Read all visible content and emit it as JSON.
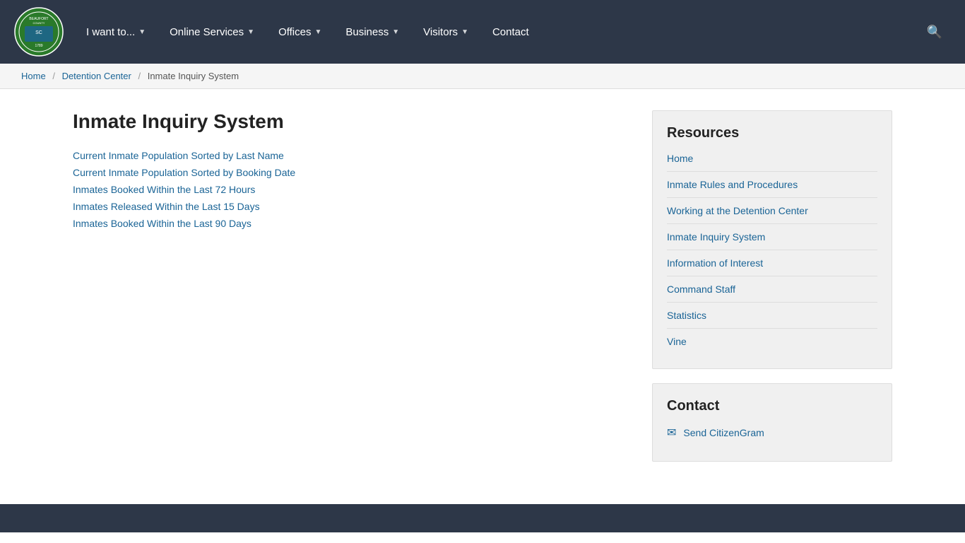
{
  "navbar": {
    "logo_alt": "Beaufort County South Carolina seal",
    "nav_items": [
      {
        "label": "I want to...",
        "has_dropdown": true
      },
      {
        "label": "Online Services",
        "has_dropdown": true
      },
      {
        "label": "Offices",
        "has_dropdown": true
      },
      {
        "label": "Business",
        "has_dropdown": true
      },
      {
        "label": "Visitors",
        "has_dropdown": true
      },
      {
        "label": "Contact",
        "has_dropdown": false
      }
    ],
    "search_label": "Search"
  },
  "breadcrumb": {
    "home": "Home",
    "parent": "Detention Center",
    "current": "Inmate Inquiry System"
  },
  "content": {
    "title": "Inmate Inquiry System",
    "links": [
      {
        "text": "Current Inmate Population Sorted by Last Name",
        "href": "#"
      },
      {
        "text": "Current Inmate Population Sorted by Booking Date",
        "href": "#"
      },
      {
        "text": "Inmates Booked Within the Last 72 Hours",
        "href": "#"
      },
      {
        "text": "Inmates Released Within the Last 15 Days",
        "href": "#"
      },
      {
        "text": "Inmates Booked Within the Last 90 Days",
        "href": "#"
      }
    ]
  },
  "sidebar": {
    "resources_title": "Resources",
    "resource_links": [
      {
        "text": "Home"
      },
      {
        "text": "Inmate Rules and Procedures"
      },
      {
        "text": "Working at the Detention Center"
      },
      {
        "text": "Inmate Inquiry System"
      },
      {
        "text": "Information of Interest"
      },
      {
        "text": "Command Staff"
      },
      {
        "text": "Statistics"
      },
      {
        "text": "Vine"
      }
    ],
    "contact_title": "Contact",
    "contact_links": [
      {
        "text": "Send CitizenGram"
      }
    ]
  }
}
